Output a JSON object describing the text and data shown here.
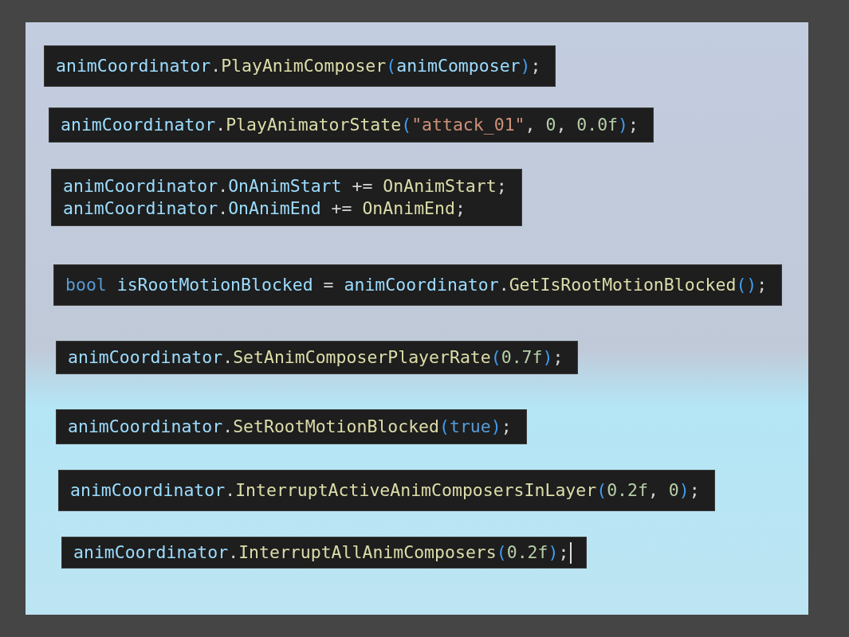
{
  "snippets": [
    {
      "cursor": false,
      "lines": [
        [
          {
            "text": "animCoordinator",
            "kind": "ident"
          },
          {
            "text": ".",
            "kind": "punct"
          },
          {
            "text": "PlayAnimComposer",
            "kind": "method"
          },
          {
            "text": "(",
            "kind": "paren"
          },
          {
            "text": "animComposer",
            "kind": "ident"
          },
          {
            "text": ")",
            "kind": "paren"
          },
          {
            "text": ";",
            "kind": "punct"
          }
        ]
      ]
    },
    {
      "cursor": false,
      "lines": [
        [
          {
            "text": "animCoordinator",
            "kind": "ident"
          },
          {
            "text": ".",
            "kind": "punct"
          },
          {
            "text": "PlayAnimatorState",
            "kind": "method"
          },
          {
            "text": "(",
            "kind": "paren"
          },
          {
            "text": "\"attack_01\"",
            "kind": "string"
          },
          {
            "text": ", ",
            "kind": "punct"
          },
          {
            "text": "0",
            "kind": "number"
          },
          {
            "text": ", ",
            "kind": "punct"
          },
          {
            "text": "0.0f",
            "kind": "number"
          },
          {
            "text": ")",
            "kind": "paren"
          },
          {
            "text": ";",
            "kind": "punct"
          }
        ]
      ]
    },
    {
      "cursor": false,
      "lines": [
        [
          {
            "text": "animCoordinator",
            "kind": "ident"
          },
          {
            "text": ".",
            "kind": "punct"
          },
          {
            "text": "OnAnimStart",
            "kind": "ident"
          },
          {
            "text": " += ",
            "kind": "punct"
          },
          {
            "text": "OnAnimStart",
            "kind": "method"
          },
          {
            "text": ";",
            "kind": "punct"
          }
        ],
        [
          {
            "text": "animCoordinator",
            "kind": "ident"
          },
          {
            "text": ".",
            "kind": "punct"
          },
          {
            "text": "OnAnimEnd",
            "kind": "ident"
          },
          {
            "text": " += ",
            "kind": "punct"
          },
          {
            "text": "OnAnimEnd",
            "kind": "method"
          },
          {
            "text": ";",
            "kind": "punct"
          }
        ]
      ]
    },
    {
      "cursor": false,
      "lines": [
        [
          {
            "text": "bool",
            "kind": "keyword"
          },
          {
            "text": " isRootMotionBlocked",
            "kind": "ident"
          },
          {
            "text": " = ",
            "kind": "punct"
          },
          {
            "text": "animCoordinator",
            "kind": "ident"
          },
          {
            "text": ".",
            "kind": "punct"
          },
          {
            "text": "GetIsRootMotionBlocked",
            "kind": "method"
          },
          {
            "text": "()",
            "kind": "paren"
          },
          {
            "text": ";",
            "kind": "punct"
          }
        ]
      ]
    },
    {
      "cursor": false,
      "lines": [
        [
          {
            "text": "animCoordinator",
            "kind": "ident"
          },
          {
            "text": ".",
            "kind": "punct"
          },
          {
            "text": "SetAnimComposerPlayerRate",
            "kind": "method"
          },
          {
            "text": "(",
            "kind": "paren"
          },
          {
            "text": "0.7f",
            "kind": "number"
          },
          {
            "text": ")",
            "kind": "paren"
          },
          {
            "text": ";",
            "kind": "punct"
          }
        ]
      ]
    },
    {
      "cursor": false,
      "lines": [
        [
          {
            "text": "animCoordinator",
            "kind": "ident"
          },
          {
            "text": ".",
            "kind": "punct"
          },
          {
            "text": "SetRootMotionBlocked",
            "kind": "method"
          },
          {
            "text": "(",
            "kind": "paren"
          },
          {
            "text": "true",
            "kind": "keyword"
          },
          {
            "text": ")",
            "kind": "paren"
          },
          {
            "text": ";",
            "kind": "punct"
          }
        ]
      ]
    },
    {
      "cursor": false,
      "lines": [
        [
          {
            "text": "animCoordinator",
            "kind": "ident"
          },
          {
            "text": ".",
            "kind": "punct"
          },
          {
            "text": "InterruptActiveAnimComposersInLayer",
            "kind": "method"
          },
          {
            "text": "(",
            "kind": "paren"
          },
          {
            "text": "0.2f",
            "kind": "number"
          },
          {
            "text": ", ",
            "kind": "punct"
          },
          {
            "text": "0",
            "kind": "number"
          },
          {
            "text": ")",
            "kind": "paren"
          },
          {
            "text": ";",
            "kind": "punct"
          }
        ]
      ]
    },
    {
      "cursor": true,
      "lines": [
        [
          {
            "text": "animCoordinator",
            "kind": "ident"
          },
          {
            "text": ".",
            "kind": "punct"
          },
          {
            "text": "InterruptAllAnimComposers",
            "kind": "method"
          },
          {
            "text": "(",
            "kind": "paren"
          },
          {
            "text": "0.2f",
            "kind": "number"
          },
          {
            "text": ")",
            "kind": "paren"
          },
          {
            "text": ";",
            "kind": "punct"
          }
        ]
      ]
    }
  ]
}
